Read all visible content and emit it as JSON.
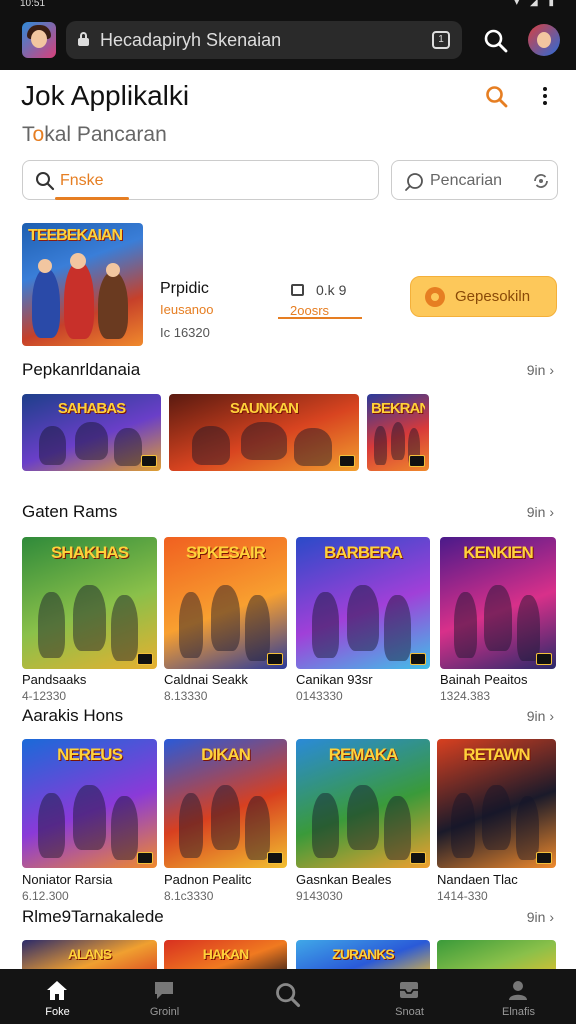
{
  "status_bar": {
    "time": "10:51",
    "icons": "▾ ◢ ▮"
  },
  "browser": {
    "url": "Hecadapiryh Skenaian",
    "tab_count": "1"
  },
  "header": {
    "title": "Jok Applikalki",
    "subtitle_prefix": "T",
    "subtitle_accent": "o",
    "subtitle_rest": "kal Pancaran"
  },
  "search": {
    "value": "Fnske",
    "alt_placeholder": "Pencarian"
  },
  "featured": {
    "banner": "TEEBEKAIAN",
    "name": "Prpidic",
    "developer": "Ieusanoo",
    "size": "Ic 16320",
    "rating": "0.k 9",
    "downloads": "2oosrs",
    "install_label": "Gepesokiln"
  },
  "sections": [
    {
      "title": "Pepkanrldanaia",
      "more": "9in ›",
      "games": [
        {
          "banner": "SAHABAS",
          "colors": [
            "#1d3f8a",
            "#6a3fc8",
            "#e0a030"
          ]
        },
        {
          "banner": "SAUNKAN",
          "colors": [
            "#5a1a10",
            "#d84420",
            "#f2a030"
          ]
        },
        {
          "banner": "BEKRAN",
          "colors": [
            "#2a3a9a",
            "#d83a3a",
            "#f08a2c"
          ]
        }
      ]
    },
    {
      "title": "Gaten Rams",
      "more": "9in ›",
      "games": [
        {
          "banner": "SHAKHAS",
          "name": "Pandsaaks",
          "meta": "4-12330",
          "colors": [
            "#2f8a3a",
            "#8ac04a",
            "#e6b030"
          ]
        },
        {
          "banner": "SPKESAIR",
          "name": "Caldnai Seakk",
          "meta": "8.13330",
          "colors": [
            "#f06020",
            "#f8a030",
            "#2a3a9a"
          ]
        },
        {
          "banner": "BARBERA",
          "name": "Canikan 93sr",
          "meta": "0143330",
          "colors": [
            "#2a4ac8",
            "#a040d8",
            "#40c0e8"
          ]
        },
        {
          "banner": "KENKIEN",
          "name": "Bainah Peaitos",
          "meta": "1324.383",
          "colors": [
            "#4a1a8a",
            "#d8308a",
            "#2a2a6a"
          ]
        }
      ]
    },
    {
      "title": "Aarakis Hons",
      "more": "9in ›",
      "games": [
        {
          "banner": "NEREUS",
          "name": "Noniator Rarsia",
          "meta": "6.12.300",
          "colors": [
            "#1a6ad8",
            "#8a3ad8",
            "#f08a2c"
          ]
        },
        {
          "banner": "DIKAN",
          "name": "Padnon Pealitc",
          "meta": "8.1c3330",
          "colors": [
            "#2a5ad8",
            "#d84020",
            "#f2c030"
          ]
        },
        {
          "banner": "REMAKA",
          "name": "Gasnkan Beales",
          "meta": "9143030",
          "colors": [
            "#2a8ad8",
            "#3a9a3a",
            "#f0a030"
          ]
        },
        {
          "banner": "RETAWN",
          "name": "Nandaen Tlac",
          "meta": "1414-330",
          "colors": [
            "#d84020",
            "#1a1a2a",
            "#f08a2c"
          ]
        }
      ]
    },
    {
      "title": "Rlme9Tarnakalede",
      "more": "9in ›",
      "games": [
        {
          "banner": "ALANS",
          "colors": [
            "#2a2a6a",
            "#f0a030",
            "#d84020"
          ]
        },
        {
          "banner": "HAKAN",
          "colors": [
            "#d83020",
            "#f07a20",
            "#2a1a1a"
          ]
        },
        {
          "banner": "ZURANKS",
          "colors": [
            "#40a8e8",
            "#2a5ad8",
            "#f0c030"
          ]
        },
        {
          "banner": "",
          "colors": [
            "#3a9a3a",
            "#8ac04a",
            "#e0c030"
          ]
        }
      ]
    }
  ],
  "bottom_nav": [
    {
      "label": "Foke",
      "icon": "home-icon"
    },
    {
      "label": "Groinl",
      "icon": "chat-icon"
    },
    {
      "label": "",
      "icon": "search-icon"
    },
    {
      "label": "Snoat",
      "icon": "inbox-icon"
    },
    {
      "label": "Elnafis",
      "icon": "profile-icon"
    }
  ],
  "colors": {
    "accent": "#e67e22",
    "install_bg": "#fdc85a",
    "bar": "#141414"
  }
}
